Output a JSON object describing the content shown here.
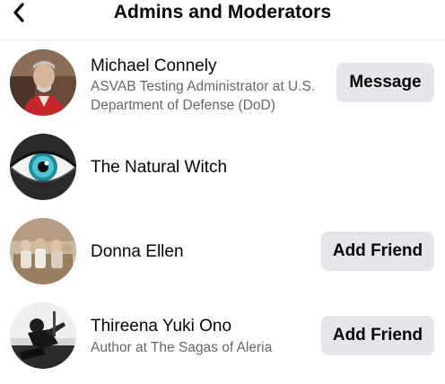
{
  "header": {
    "title": "Admins and Moderators",
    "back_icon": "chevron-left-icon"
  },
  "members": [
    {
      "name": "Michael Connely",
      "subtitle_line1": "ASVAB Testing Administrator at U.S.",
      "subtitle_line2": "Department of Defense (DoD)",
      "action_label": "Message"
    },
    {
      "name": "The Natural Witch"
    },
    {
      "name": "Donna Ellen",
      "action_label": "Add Friend"
    },
    {
      "name": "Thireena Yuki Ono",
      "subtitle_line1": "Author at The Sagas of Aleria",
      "action_label": "Add Friend"
    }
  ],
  "colors": {
    "button_bg": "#e4e6eb",
    "primary_text": "#050505",
    "secondary_text": "#65676b"
  }
}
